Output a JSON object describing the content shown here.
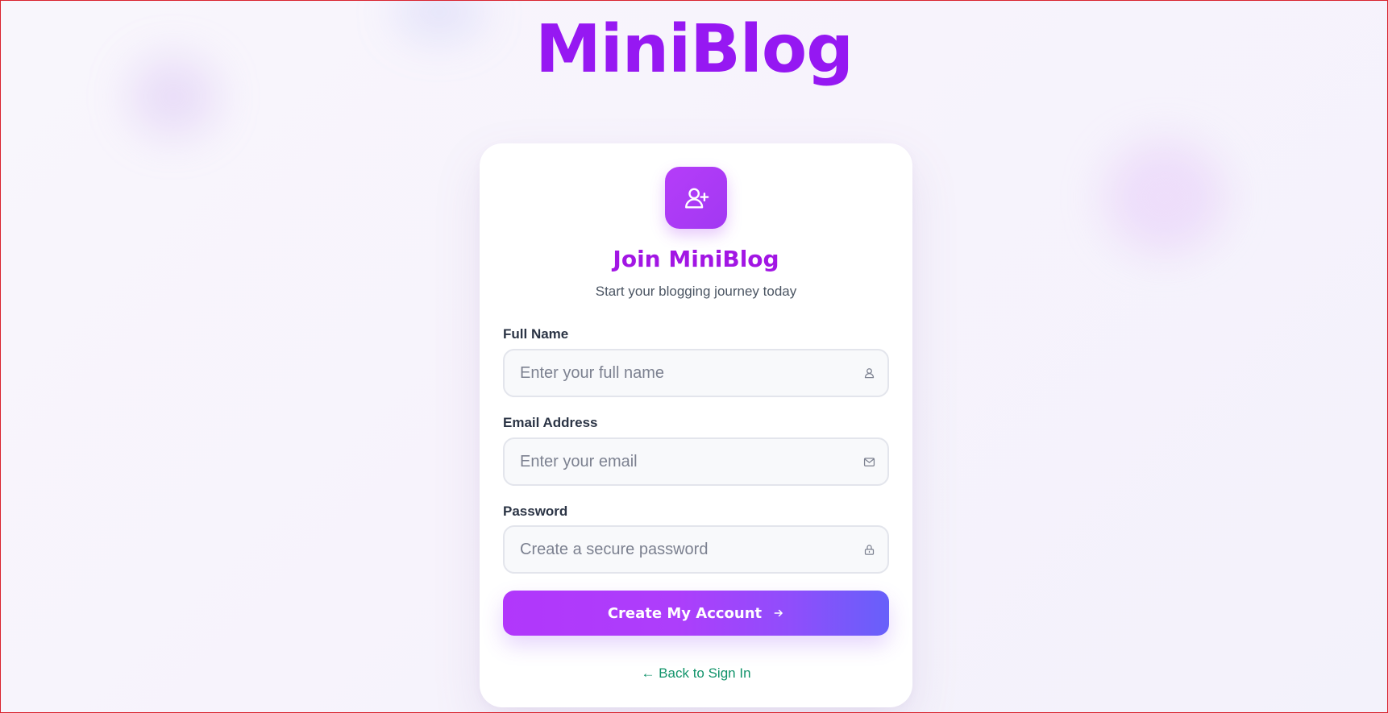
{
  "brand": {
    "name": "MiniBlog"
  },
  "signup": {
    "icon": "user-plus-icon",
    "title": "Join MiniBlog",
    "subtitle": "Start your blogging journey today",
    "fields": [
      {
        "label": "Full Name",
        "placeholder": "Enter your full name",
        "value": "",
        "icon": "user-icon"
      },
      {
        "label": "Email Address",
        "placeholder": "Enter your email",
        "value": "",
        "icon": "mail-icon"
      },
      {
        "label": "Password",
        "placeholder": "Create a secure password",
        "value": "",
        "icon": "lock-icon"
      }
    ],
    "submit_label": "Create My Account",
    "submit_icon": "arrow-right-icon",
    "back_link": "← Back to Sign In"
  },
  "colors": {
    "brand_purple": "#9a18f2",
    "brand_indigo": "#6046f5",
    "button_start": "#b137fb",
    "button_end": "#6760fa",
    "link_green": "#10936a",
    "frame_border": "#d9232e"
  }
}
